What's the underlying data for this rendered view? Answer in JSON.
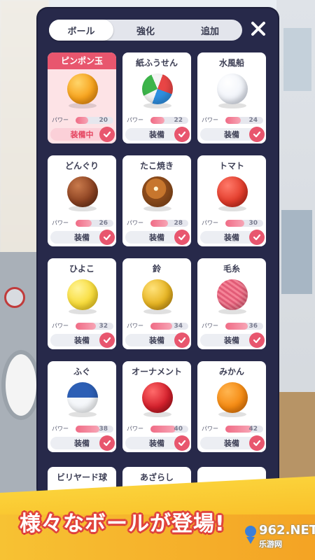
{
  "tabs": [
    {
      "label": "ボール",
      "active": true
    },
    {
      "label": "強化",
      "active": false
    },
    {
      "label": "追加",
      "active": false
    }
  ],
  "power_label": "パワー",
  "power_max": 60,
  "balls": [
    {
      "name": "ピンポン玉",
      "power": "20",
      "equip": "装備中",
      "selected": true,
      "icon": "ping-pong-ball-icon"
    },
    {
      "name": "紙ふうせん",
      "power": "22",
      "equip": "装備",
      "selected": false,
      "icon": "paper-balloon-icon"
    },
    {
      "name": "水風船",
      "power": "24",
      "equip": "装備",
      "selected": false,
      "icon": "water-balloon-icon"
    },
    {
      "name": "どんぐり",
      "power": "26",
      "equip": "装備",
      "selected": false,
      "icon": "acorn-icon"
    },
    {
      "name": "たこ焼き",
      "power": "28",
      "equip": "装備",
      "selected": false,
      "icon": "takoyaki-icon"
    },
    {
      "name": "トマト",
      "power": "30",
      "equip": "装備",
      "selected": false,
      "icon": "tomato-icon"
    },
    {
      "name": "ひよこ",
      "power": "32",
      "equip": "装備",
      "selected": false,
      "icon": "chick-icon"
    },
    {
      "name": "鈴",
      "power": "34",
      "equip": "装備",
      "selected": false,
      "icon": "bell-icon"
    },
    {
      "name": "毛糸",
      "power": "36",
      "equip": "装備",
      "selected": false,
      "icon": "yarn-ball-icon"
    },
    {
      "name": "ふぐ",
      "power": "38",
      "equip": "装備",
      "selected": false,
      "icon": "pufferfish-icon"
    },
    {
      "name": "オーナメント",
      "power": "40",
      "equip": "装備",
      "selected": false,
      "icon": "ornament-icon"
    },
    {
      "name": "みかん",
      "power": "42",
      "equip": "装備",
      "selected": false,
      "icon": "mandarin-orange-icon"
    }
  ],
  "partial_balls": [
    {
      "name": "ビリヤード球"
    },
    {
      "name": "あざらし"
    },
    {
      "name": ""
    }
  ],
  "banner_text": "様々なボールが登場!",
  "watermark": {
    "number": "962",
    "suffix": ".NET",
    "site": "乐游网"
  },
  "colors": {
    "panel": "#27294a",
    "accent": "#e8566e",
    "banner": "#f9b41f"
  }
}
